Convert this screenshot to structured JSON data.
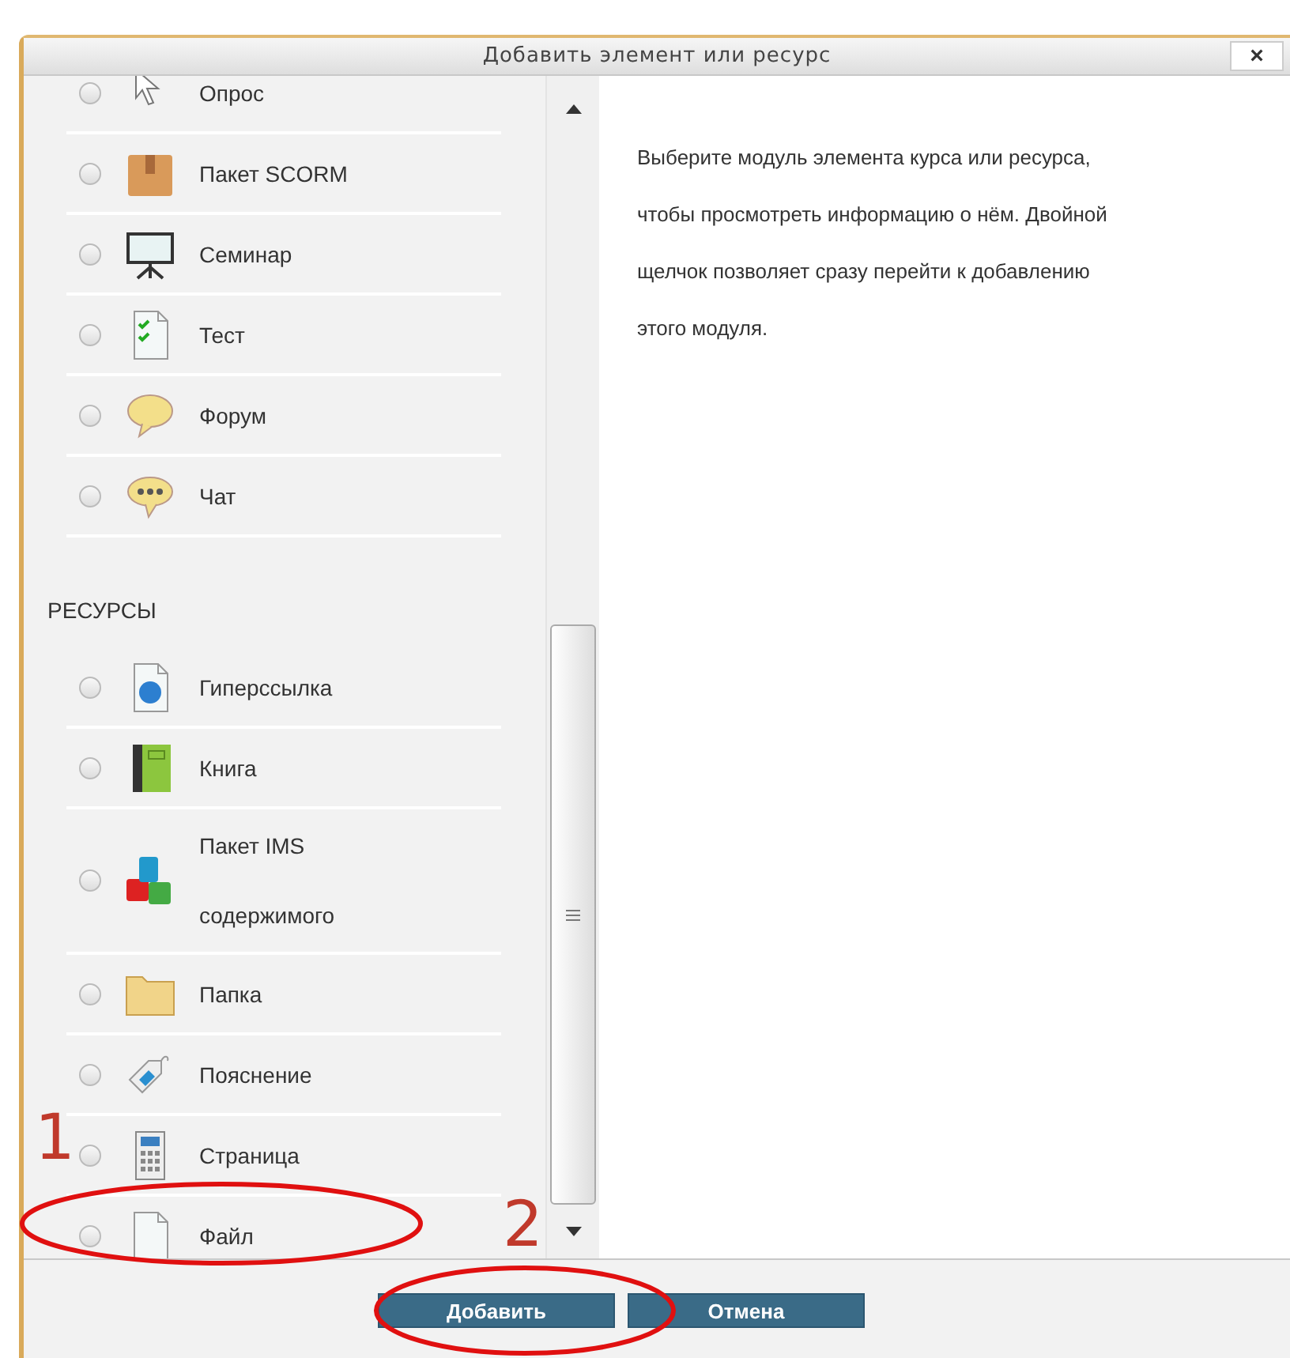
{
  "dialog": {
    "title": "Добавить элемент или ресурс",
    "close": "×"
  },
  "sections": [
    {
      "items": [
        {
          "label": "Опрос",
          "selected": false
        },
        {
          "label": "Пакет SCORM",
          "selected": false
        },
        {
          "label": "Семинар",
          "selected": false
        },
        {
          "label": "Тест",
          "selected": false
        },
        {
          "label": "Форум",
          "selected": false
        },
        {
          "label": "Чат",
          "selected": false
        }
      ]
    },
    {
      "heading": "РЕСУРСЫ",
      "items": [
        {
          "label": "Гиперссылка",
          "selected": false
        },
        {
          "label": "Книга",
          "selected": false
        },
        {
          "label": "Пакет IMS содержимого",
          "selected": false
        },
        {
          "label": "Папка",
          "selected": false
        },
        {
          "label": "Пояснение",
          "selected": false
        },
        {
          "label": "Страница",
          "selected": false
        },
        {
          "label": "Файл",
          "selected": false
        }
      ]
    }
  ],
  "info": "Выберите модуль элемента курса или ресурса, чтобы просмотреть информацию о нём. Двойной щелчок позволяет сразу перейти к добавлению этого модуля.",
  "buttons": [
    {
      "label": "Добавить"
    },
    {
      "label": "Отмена"
    }
  ],
  "annotations": [
    {
      "number": "1"
    },
    {
      "number": "2"
    }
  ]
}
